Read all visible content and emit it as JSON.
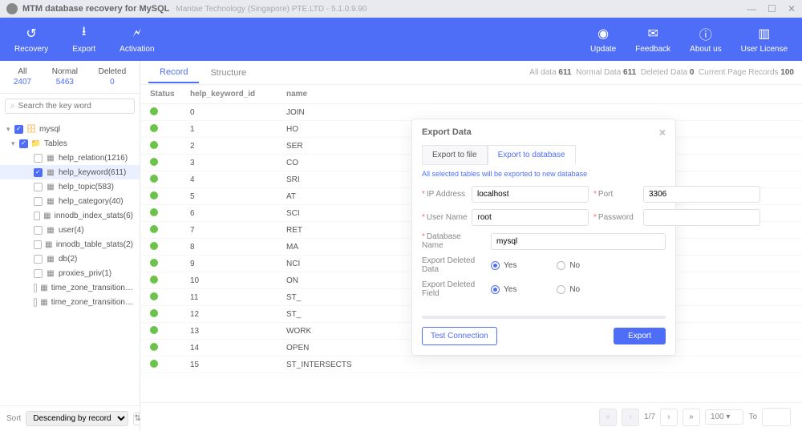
{
  "titlebar": {
    "app_name": "MTM database recovery for MySQL",
    "vendor": "Mantae Technology (Singapore) PTE.LTD - 5.1.0.9.90"
  },
  "toolbar": {
    "left": [
      {
        "key": "recovery",
        "label": "Recovery",
        "icon": "↺"
      },
      {
        "key": "export",
        "label": "Export",
        "icon": "⭳"
      },
      {
        "key": "activation",
        "label": "Activation",
        "icon": "🗲"
      }
    ],
    "right": [
      {
        "key": "update",
        "label": "Update",
        "icon": "◉"
      },
      {
        "key": "feedback",
        "label": "Feedback",
        "icon": "✉"
      },
      {
        "key": "about",
        "label": "About us",
        "icon": "ⓘ"
      },
      {
        "key": "license",
        "label": "User License",
        "icon": "▥"
      }
    ]
  },
  "sidebar": {
    "counts": {
      "all_label": "All",
      "all": "2407",
      "normal_label": "Normal",
      "normal": "5463",
      "deleted_label": "Deleted",
      "deleted": "0"
    },
    "search_placeholder": "Search the key word",
    "root_label": "mysql",
    "tables_label": "Tables",
    "tables": [
      {
        "label": "help_relation(1216)",
        "selected": false,
        "checked": false
      },
      {
        "label": "help_keyword(611)",
        "selected": true,
        "checked": true
      },
      {
        "label": "help_topic(583)",
        "selected": false,
        "checked": false
      },
      {
        "label": "help_category(40)",
        "selected": false,
        "checked": false
      },
      {
        "label": "innodb_index_stats(6)",
        "selected": false,
        "checked": false
      },
      {
        "label": "user(4)",
        "selected": false,
        "checked": false
      },
      {
        "label": "innodb_table_stats(2)",
        "selected": false,
        "checked": false
      },
      {
        "label": "db(2)",
        "selected": false,
        "checked": false
      },
      {
        "label": "proxies_priv(1)",
        "selected": false,
        "checked": false
      },
      {
        "label": "time_zone_transition…",
        "selected": false,
        "checked": false
      },
      {
        "label": "time_zone_transition…",
        "selected": false,
        "checked": false
      }
    ],
    "sort_label": "Sort",
    "sort_value": "Descending by record"
  },
  "content": {
    "tabs": {
      "record": "Record",
      "structure": "Structure"
    },
    "info": {
      "prefix_all": "All data",
      "all": "611",
      "prefix_normal": "Normal Data",
      "normal": "611",
      "prefix_deleted": "Deleted Data",
      "deleted": "0",
      "prefix_page": "Current Page Records",
      "page": "100"
    },
    "columns": {
      "status": "Status",
      "id": "help_keyword_id",
      "name": "name"
    },
    "rows": [
      {
        "id": "0",
        "name": "JOIN"
      },
      {
        "id": "1",
        "name": "HO"
      },
      {
        "id": "2",
        "name": "SER"
      },
      {
        "id": "3",
        "name": "CO"
      },
      {
        "id": "4",
        "name": "SRI"
      },
      {
        "id": "5",
        "name": "AT"
      },
      {
        "id": "6",
        "name": "SCI"
      },
      {
        "id": "7",
        "name": "RET"
      },
      {
        "id": "8",
        "name": "MA"
      },
      {
        "id": "9",
        "name": "NCI"
      },
      {
        "id": "10",
        "name": "ON"
      },
      {
        "id": "11",
        "name": "ST_"
      },
      {
        "id": "12",
        "name": "ST_"
      },
      {
        "id": "13",
        "name": "WORK"
      },
      {
        "id": "14",
        "name": "OPEN"
      },
      {
        "id": "15",
        "name": "ST_INTERSECTS"
      }
    ],
    "pager": {
      "pages": "1/7",
      "page_size": "100",
      "to_label": "To"
    }
  },
  "modal": {
    "title": "Export Data",
    "tab_file": "Export to file",
    "tab_db": "Export to database",
    "hint": "All selected tables will be exported to new database",
    "ip_label": "IP Address",
    "ip_value": "localhost",
    "port_label": "Port",
    "port_value": "3306",
    "user_label": "User Name",
    "user_value": "root",
    "pwd_label": "Password",
    "pwd_value": "",
    "db_label": "Database Name",
    "db_value": "mysql",
    "exp_del_data_label": "Export Deleted Data",
    "yes": "Yes",
    "no": "No",
    "exp_del_field_label": "Export Deleted Field",
    "test_btn": "Test Connection",
    "export_btn": "Export"
  }
}
